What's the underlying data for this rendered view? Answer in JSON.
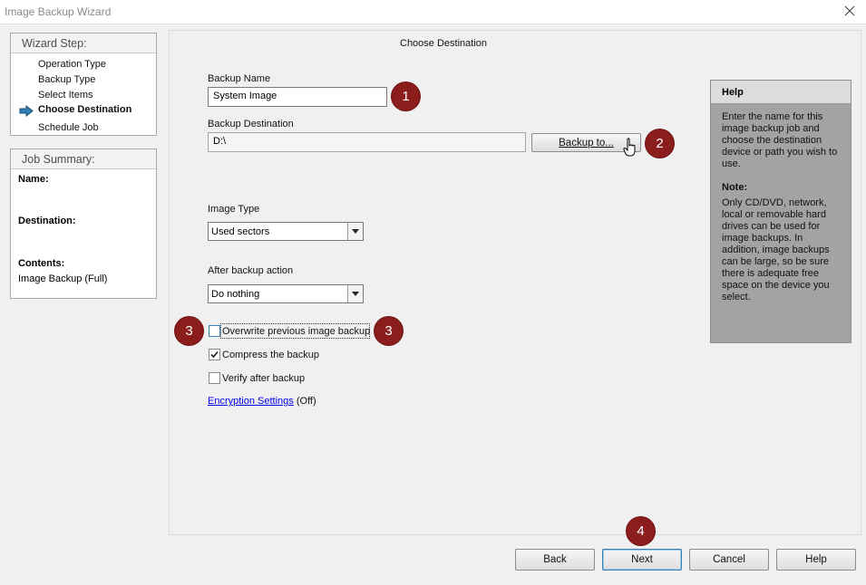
{
  "window": {
    "title": "Image Backup Wizard",
    "close_icon": "close-icon"
  },
  "wizard_step": {
    "heading": "Wizard Step:",
    "steps": [
      "Operation Type",
      "Backup Type",
      "Select Items",
      "Choose Destination",
      "Schedule Job"
    ],
    "current_index": 3
  },
  "job_summary": {
    "heading": "Job Summary:",
    "name_label": "Name:",
    "destination_label": "Destination:",
    "contents_label": "Contents:",
    "contents_value": "Image Backup (Full)"
  },
  "main": {
    "page_title": "Choose Destination",
    "backup_name": {
      "label": "Backup Name",
      "value": "System Image"
    },
    "backup_destination": {
      "label": "Backup Destination",
      "value": "D:\\",
      "button": "Backup to..."
    },
    "image_type": {
      "label": "Image Type",
      "selected": "Used sectors"
    },
    "after_action": {
      "label": "After backup action",
      "selected": "Do nothing"
    },
    "checkboxes": [
      {
        "label": "Overwrite previous image backup",
        "checked": false
      },
      {
        "label": "Compress the backup",
        "checked": true
      },
      {
        "label": "Verify after backup",
        "checked": false
      }
    ],
    "encryption": {
      "link": "Encryption Settings",
      "status": "(Off)"
    }
  },
  "help": {
    "title": "Help",
    "text": "Enter the name for this image backup job and choose the destination device or path you wish to use.",
    "note_title": "Note:",
    "note_text": "Only CD/DVD, network, local or removable hard drives can be used for image backups.  In addition, image backups can be large, so be sure there is adequate free space on the device you select."
  },
  "badges": {
    "b1": "1",
    "b2": "2",
    "b3a": "3",
    "b3b": "3",
    "b4": "4"
  },
  "buttons": {
    "back": "Back",
    "next": "Next",
    "cancel": "Cancel",
    "help": "Help"
  },
  "colors": {
    "badge": "#8b1d1d",
    "help_panel": "#a3a3a3",
    "link": "#0000ee"
  }
}
